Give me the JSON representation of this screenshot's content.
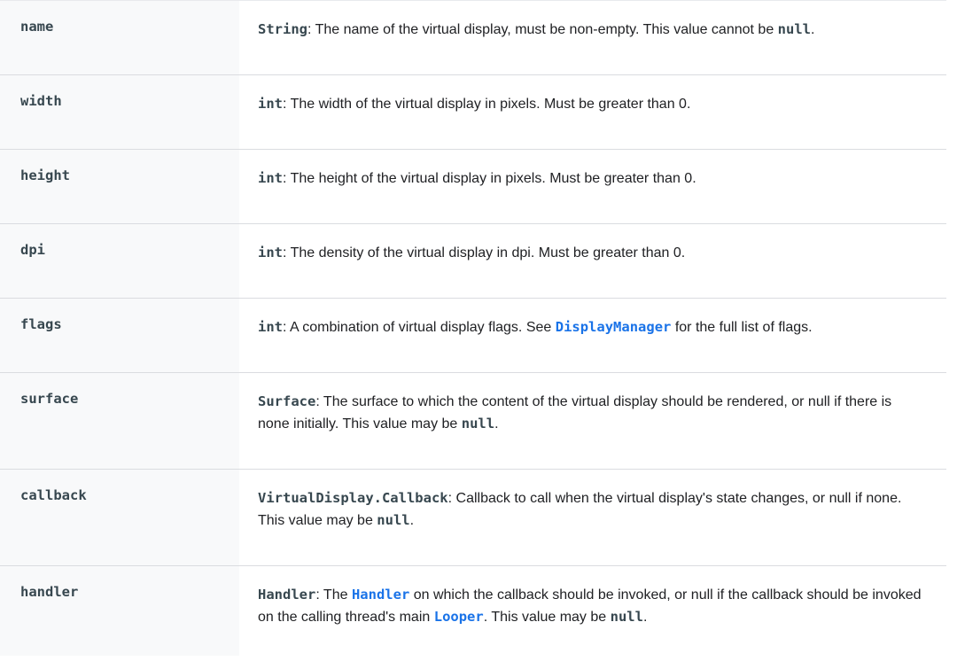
{
  "params": [
    {
      "name": "name",
      "desc": [
        {
          "t": "String",
          "s": "code"
        },
        {
          "t": ": The name of the virtual display, must be non-empty. This value cannot be ",
          "s": "text"
        },
        {
          "t": "null",
          "s": "code"
        },
        {
          "t": ".",
          "s": "text"
        }
      ]
    },
    {
      "name": "width",
      "desc": [
        {
          "t": "int",
          "s": "code"
        },
        {
          "t": ": The width of the virtual display in pixels. Must be greater than 0.",
          "s": "text"
        }
      ]
    },
    {
      "name": "height",
      "desc": [
        {
          "t": "int",
          "s": "code"
        },
        {
          "t": ": The height of the virtual display in pixels. Must be greater than 0.",
          "s": "text"
        }
      ]
    },
    {
      "name": "dpi",
      "desc": [
        {
          "t": "int",
          "s": "code"
        },
        {
          "t": ": The density of the virtual display in dpi. Must be greater than 0.",
          "s": "text"
        }
      ]
    },
    {
      "name": "flags",
      "desc": [
        {
          "t": "int",
          "s": "code"
        },
        {
          "t": ": A combination of virtual display flags. See ",
          "s": "text"
        },
        {
          "t": "DisplayManager",
          "s": "link"
        },
        {
          "t": " for the full list of flags.",
          "s": "text"
        }
      ]
    },
    {
      "name": "surface",
      "desc": [
        {
          "t": "Surface",
          "s": "code"
        },
        {
          "t": ": The surface to which the content of the virtual display should be rendered, or null if there is none initially. This value may be ",
          "s": "text"
        },
        {
          "t": "null",
          "s": "code"
        },
        {
          "t": ".",
          "s": "text"
        }
      ]
    },
    {
      "name": "callback",
      "desc": [
        {
          "t": "VirtualDisplay.Callback",
          "s": "code"
        },
        {
          "t": ": Callback to call when the virtual display's state changes, or null if none. This value may be ",
          "s": "text"
        },
        {
          "t": "null",
          "s": "code"
        },
        {
          "t": ".",
          "s": "text"
        }
      ]
    },
    {
      "name": "handler",
      "desc": [
        {
          "t": "Handler",
          "s": "code"
        },
        {
          "t": ": The ",
          "s": "text"
        },
        {
          "t": "Handler",
          "s": "link"
        },
        {
          "t": " on which the callback should be invoked, or null if the callback should be invoked on the calling thread's main ",
          "s": "text"
        },
        {
          "t": "Looper",
          "s": "link"
        },
        {
          "t": ". This value may be ",
          "s": "text"
        },
        {
          "t": "null",
          "s": "code"
        },
        {
          "t": ".",
          "s": "text"
        }
      ]
    }
  ]
}
